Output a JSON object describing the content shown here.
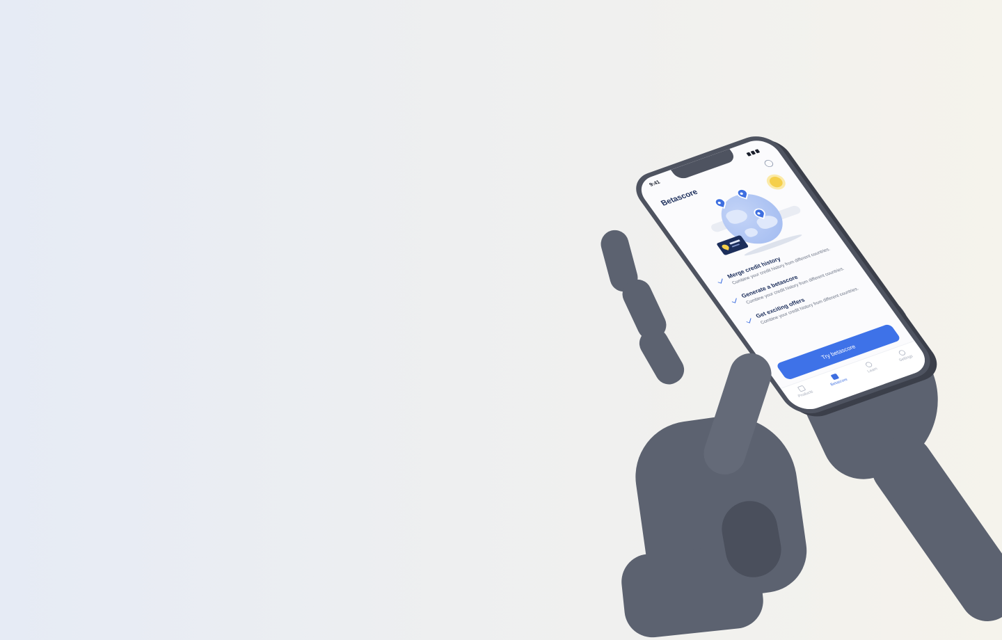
{
  "phone": {
    "status_time": "9:41",
    "title": "Betascore",
    "features": [
      {
        "title": "Merge credit history",
        "description": "Combine your credit history from different countries."
      },
      {
        "title": "Generate a betascore",
        "description": "Combine your credit history from different countries."
      },
      {
        "title": "Get exciting offers",
        "description": "Combine your credit history from different countries."
      }
    ],
    "cta_label": "Try betascore",
    "tabs": [
      {
        "label": "Products",
        "icon": "products-icon",
        "active": false
      },
      {
        "label": "Betascore",
        "icon": "betascore-icon",
        "active": true
      },
      {
        "label": "Learn",
        "icon": "bulb-icon",
        "active": false
      },
      {
        "label": "Settings",
        "icon": "settings-icon",
        "active": false
      }
    ]
  },
  "colors": {
    "brand_blue": "#3e72e8",
    "navy": "#1c2e5b",
    "hand_gray": "#5c6270",
    "sun_yellow": "#f5cf4a"
  }
}
